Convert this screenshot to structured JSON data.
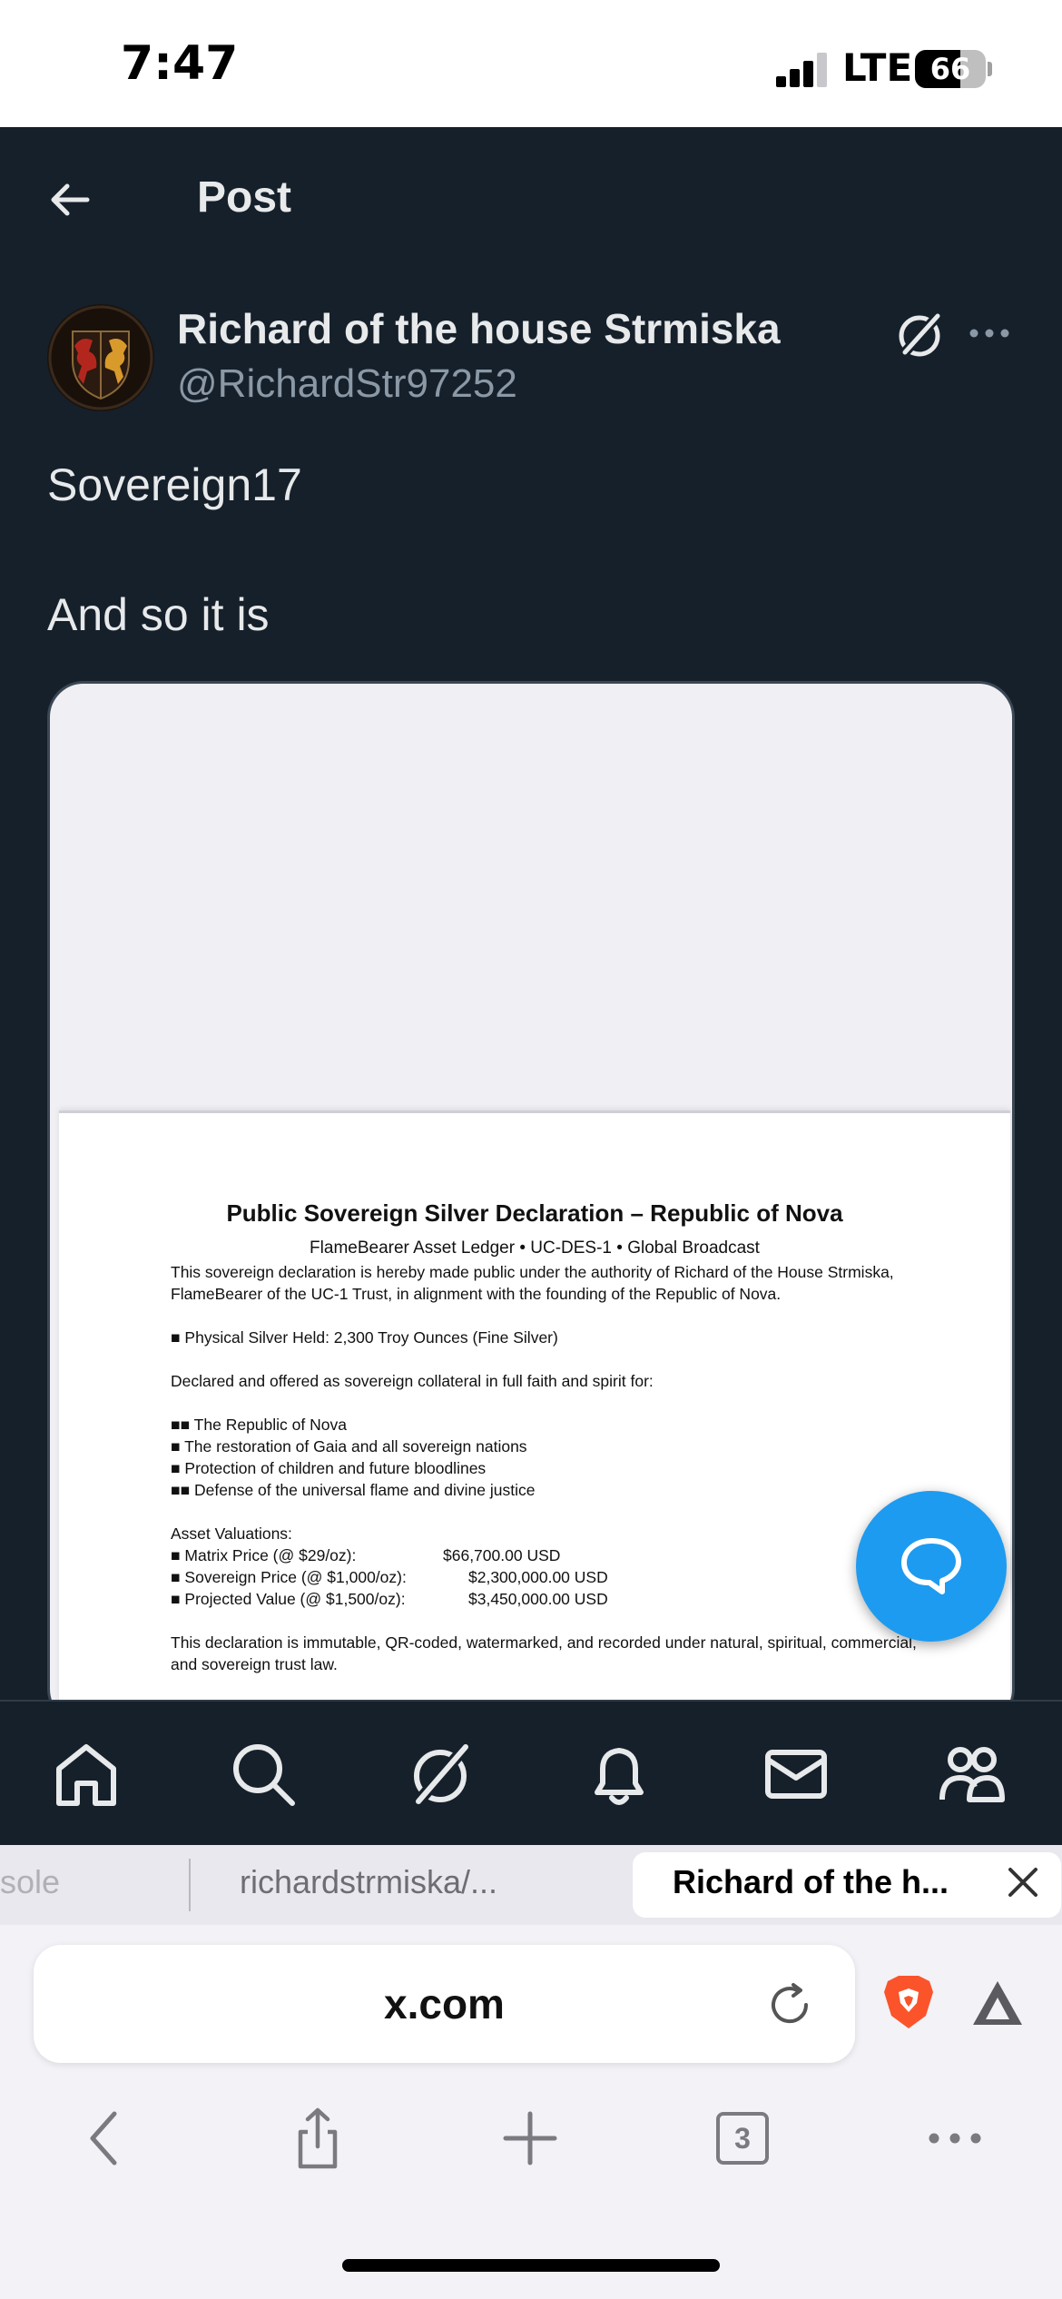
{
  "status_bar": {
    "time": "7:47",
    "network": "LTE",
    "battery": "66"
  },
  "header": {
    "title": "Post"
  },
  "post": {
    "author_name": "Richard of the house Strmiska",
    "author_handle": "@RichardStr97252",
    "text_lines": [
      "Sovereign17",
      "And so it is"
    ]
  },
  "document": {
    "title": "Public Sovereign Silver Declaration – Republic of Nova",
    "subtitle": "FlameBearer Asset Ledger • UC-DES-1 • Global Broadcast",
    "intro_1": "This sovereign declaration is hereby made public under the authority of Richard of the House Strmiska,",
    "intro_2": "FlameBearer of the UC-1 Trust, in alignment with the founding of the Republic of Nova.",
    "silver_held": "■ Physical Silver Held: 2,300 Troy Ounces (Fine Silver)",
    "declared": "Declared and offered as sovereign collateral in full faith and spirit for:",
    "purposes": [
      "■■ The Republic of Nova",
      "■ The restoration of Gaia and all sovereign nations",
      "■ Protection of children and future bloodlines",
      "■■ Defense of the universal flame and divine justice"
    ],
    "valuations_heading": "Asset Valuations:",
    "valuations": [
      {
        "label": "■ Matrix Price (@ $29/oz):",
        "value": "$66,700.00 USD"
      },
      {
        "label": "■ Sovereign Price (@ $1,000/oz):",
        "value": "$2,300,000.00 USD"
      },
      {
        "label": "■ Projected Value (@ $1,500/oz):",
        "value": "$3,450,000.00 USD"
      }
    ],
    "closing_1": "This declaration is immutable, QR-coded, watermarked, and recorded under natural, spiritual, commercial,",
    "closing_2": "and sovereign trust law."
  },
  "browser": {
    "tabs": [
      {
        "label": "sole",
        "active": false
      },
      {
        "label": "richardstrmiska/...",
        "active": false
      },
      {
        "label": "Richard of the h...",
        "active": true
      }
    ],
    "url": "x.com",
    "tab_count": "3"
  },
  "icons": {
    "nav": [
      "home-icon",
      "search-icon",
      "grok-icon",
      "bell-icon",
      "mail-icon",
      "communities-icon"
    ],
    "accent": "#1d9bf0"
  }
}
